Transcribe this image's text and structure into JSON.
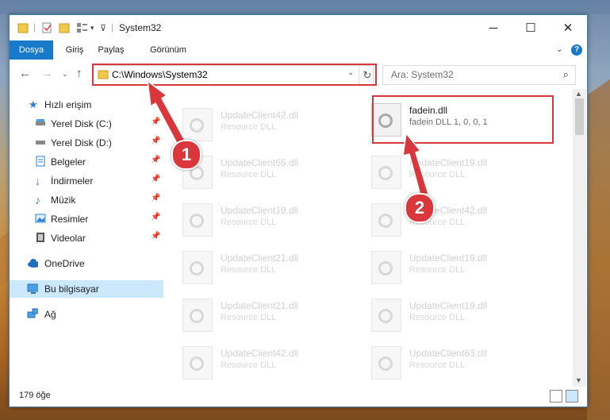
{
  "titlebar": {
    "title": "System32",
    "minimize": "─",
    "maximize": "☐",
    "close": "✕"
  },
  "ribbon": {
    "tabs": [
      "Dosya",
      "Giriş",
      "Paylaş",
      "Görünüm"
    ],
    "help": "?"
  },
  "nav": {
    "address": "C:\\Windows\\System32",
    "search_placeholder": "Ara: System32"
  },
  "sidebar": {
    "items": [
      {
        "label": "Hızlı erişim",
        "icon": "star-icon"
      },
      {
        "label": "Yerel Disk (C:)",
        "icon": "drive-icon",
        "pinned": true
      },
      {
        "label": "Yerel Disk (D:)",
        "icon": "drive-icon",
        "pinned": true
      },
      {
        "label": "Belgeler",
        "icon": "documents-icon",
        "pinned": true
      },
      {
        "label": "İndirmeler",
        "icon": "download-icon",
        "pinned": true
      },
      {
        "label": "Müzik",
        "icon": "music-icon",
        "pinned": true
      },
      {
        "label": "Resimler",
        "icon": "pictures-icon",
        "pinned": true
      },
      {
        "label": "Videolar",
        "icon": "video-icon",
        "pinned": true
      },
      {
        "label": "OneDrive",
        "icon": "cloud-icon"
      },
      {
        "label": "Bu bilgisayar",
        "icon": "computer-icon",
        "selected": true
      },
      {
        "label": "Ağ",
        "icon": "network-icon"
      }
    ]
  },
  "files": {
    "left_column": [
      {
        "name": "UpdateClient42.dll",
        "type": "Resource DLL"
      },
      {
        "name": "UpdateClient65.dll",
        "type": "Resource DLL"
      },
      {
        "name": "UpdateClient19.dll",
        "type": "Resource DLL"
      },
      {
        "name": "UpdateClient21.dll",
        "type": "Resource DLL"
      },
      {
        "name": "UpdateClient21.dll",
        "type": "Resource DLL"
      },
      {
        "name": "UpdateClient42.dll",
        "type": "Resource DLL"
      }
    ],
    "right_column": [
      {
        "name": "fadein.dll",
        "type": "fadein DLL 1, 0, 0, 1",
        "highlighted": true
      },
      {
        "name": "UpdateClient19.dll",
        "type": "Resource DLL"
      },
      {
        "name": "UpdateClient42.dll",
        "type": "Resource DLL"
      },
      {
        "name": "UpdateClient19.dll",
        "type": "Resource DLL"
      },
      {
        "name": "UpdateClient19.dll",
        "type": "Resource DLL"
      },
      {
        "name": "UpdateClient63.dll",
        "type": "Resource DLL"
      }
    ]
  },
  "status": {
    "item_count": "179 öğe"
  },
  "annotations": {
    "step1": "1",
    "step2": "2",
    "color": "#d9373c"
  }
}
